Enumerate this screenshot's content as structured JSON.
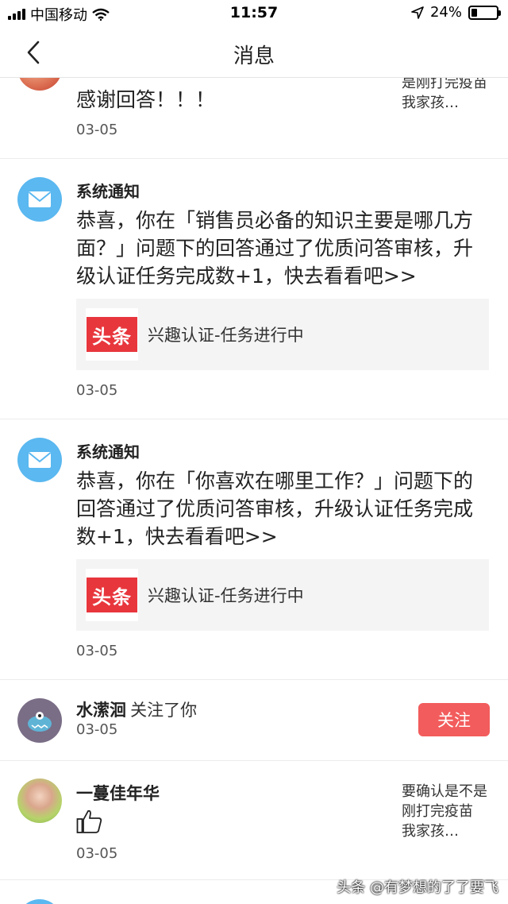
{
  "status_bar": {
    "carrier": "中国移动",
    "time": "11:57",
    "battery_percent": "24%",
    "battery_level": 0.24
  },
  "nav": {
    "title": "消息",
    "back_icon": "chevron-left-icon"
  },
  "messages": [
    {
      "body": "感谢回答！！！",
      "date": "03-05",
      "side_text": "是刚打完疫苗 我家孩…"
    },
    {
      "sender": "系统通知",
      "body": "恭喜，你在「销售员必备的知识主要是哪几方面？」问题下的回答通过了优质问答审核，升级认证任务完成数+1，快去看看吧>>",
      "card_logo": "头条",
      "card_text": "兴趣认证-任务进行中",
      "date": "03-05"
    },
    {
      "sender": "系统通知",
      "body": "恭喜，你在「你喜欢在哪里工作？」问题下的回答通过了优质问答审核，升级认证任务完成数+1，快去看看吧>>",
      "card_logo": "头条",
      "card_text": "兴趣认证-任务进行中",
      "date": "03-05"
    },
    {
      "name": "水潆洄",
      "action": "关注了你",
      "date": "03-05",
      "button": "关注"
    },
    {
      "name": "一蔓佳年华",
      "date": "03-05",
      "side_text": "要确认是不是刚打完疫苗 我家孩…"
    }
  ],
  "watermark": "头条 @有梦想的了了要飞",
  "colors": {
    "accent_red": "#f25c5c",
    "mail_blue": "#5bb8f0",
    "logo_red": "#e8363d"
  }
}
